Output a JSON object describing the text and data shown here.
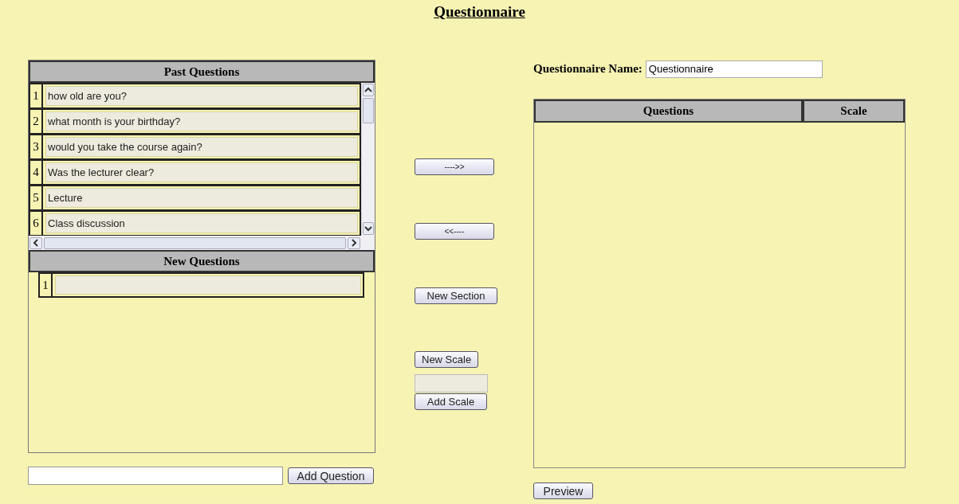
{
  "title": "Questionnaire",
  "past_questions": {
    "heading": "Past Questions",
    "rows": [
      {
        "number": "1",
        "text": "how old are you?"
      },
      {
        "number": "2",
        "text": "what month is your birthday?"
      },
      {
        "number": "3",
        "text": "would you take the course again?"
      },
      {
        "number": "4",
        "text": "Was the lecturer clear?"
      },
      {
        "number": "5",
        "text": "Lecture"
      },
      {
        "number": "6",
        "text": "Class discussion"
      }
    ]
  },
  "new_questions": {
    "heading": "New Questions",
    "rows": [
      {
        "number": "1"
      }
    ]
  },
  "add_question_button": "Add Question",
  "middle_buttons": [
    {
      "kind": "move",
      "label": "---->>"
    },
    {
      "kind": "move",
      "label": "<<----"
    },
    {
      "kind": "section",
      "label": "New Section"
    },
    {
      "kind": "scale",
      "label": "New Scale"
    }
  ],
  "add_scale_button": "Add Scale",
  "questionnaire_name": {
    "label": "Questionnaire Name:",
    "value": "Questionnaire"
  },
  "table": {
    "columns": [
      "Questions",
      "Scale"
    ]
  },
  "preview_button": "Preview"
}
